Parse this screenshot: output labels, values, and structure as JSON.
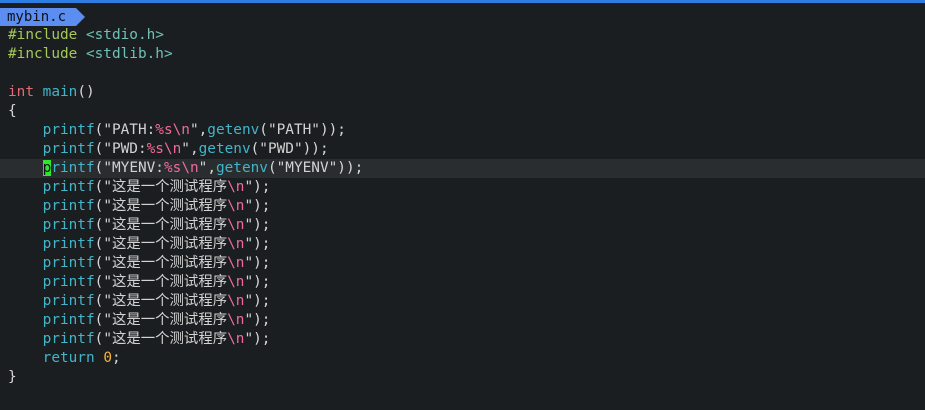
{
  "tab": {
    "filename": "mybin.c"
  },
  "code": {
    "include1": {
      "directive": "#include",
      "header": "<stdio.h>"
    },
    "include2": {
      "directive": "#include",
      "header": "<stdlib.h>"
    },
    "main_sig": {
      "type": "int",
      "name": "main",
      "parens": "()"
    },
    "open_brace": "{",
    "close_brace": "}",
    "printf_path": {
      "fn": "printf",
      "open": "(",
      "str1": "\"PATH:",
      "fmt": "%s",
      "esc": "\\n",
      "str2": "\"",
      "comma": ",",
      "getenv": "getenv",
      "arg_open": "(",
      "arg": "\"PATH\"",
      "tail": "));"
    },
    "printf_pwd": {
      "fn": "printf",
      "open": "(",
      "str1": "\"PWD:",
      "fmt": "%s",
      "esc": "\\n",
      "str2": "\"",
      "comma": ",",
      "getenv": "getenv",
      "arg_open": "(",
      "arg": "\"PWD\"",
      "tail": "));"
    },
    "printf_myenv": {
      "cursor_char": "p",
      "fn_rest": "rintf",
      "open": "(",
      "str1": "\"MYENV:",
      "fmt": "%s",
      "esc": "\\n",
      "str2": "\"",
      "comma": ",",
      "getenv": "getenv",
      "arg_open": "(",
      "arg": "\"MYENV\"",
      "tail": "));"
    },
    "cn_printf": {
      "fn": "printf",
      "open": "(",
      "str1": "\"这是一个测试程序",
      "esc": "\\n",
      "str2": "\"",
      "tail": ");"
    },
    "return_stmt": {
      "kw": "return",
      "num": "0",
      "semi": ";"
    }
  }
}
